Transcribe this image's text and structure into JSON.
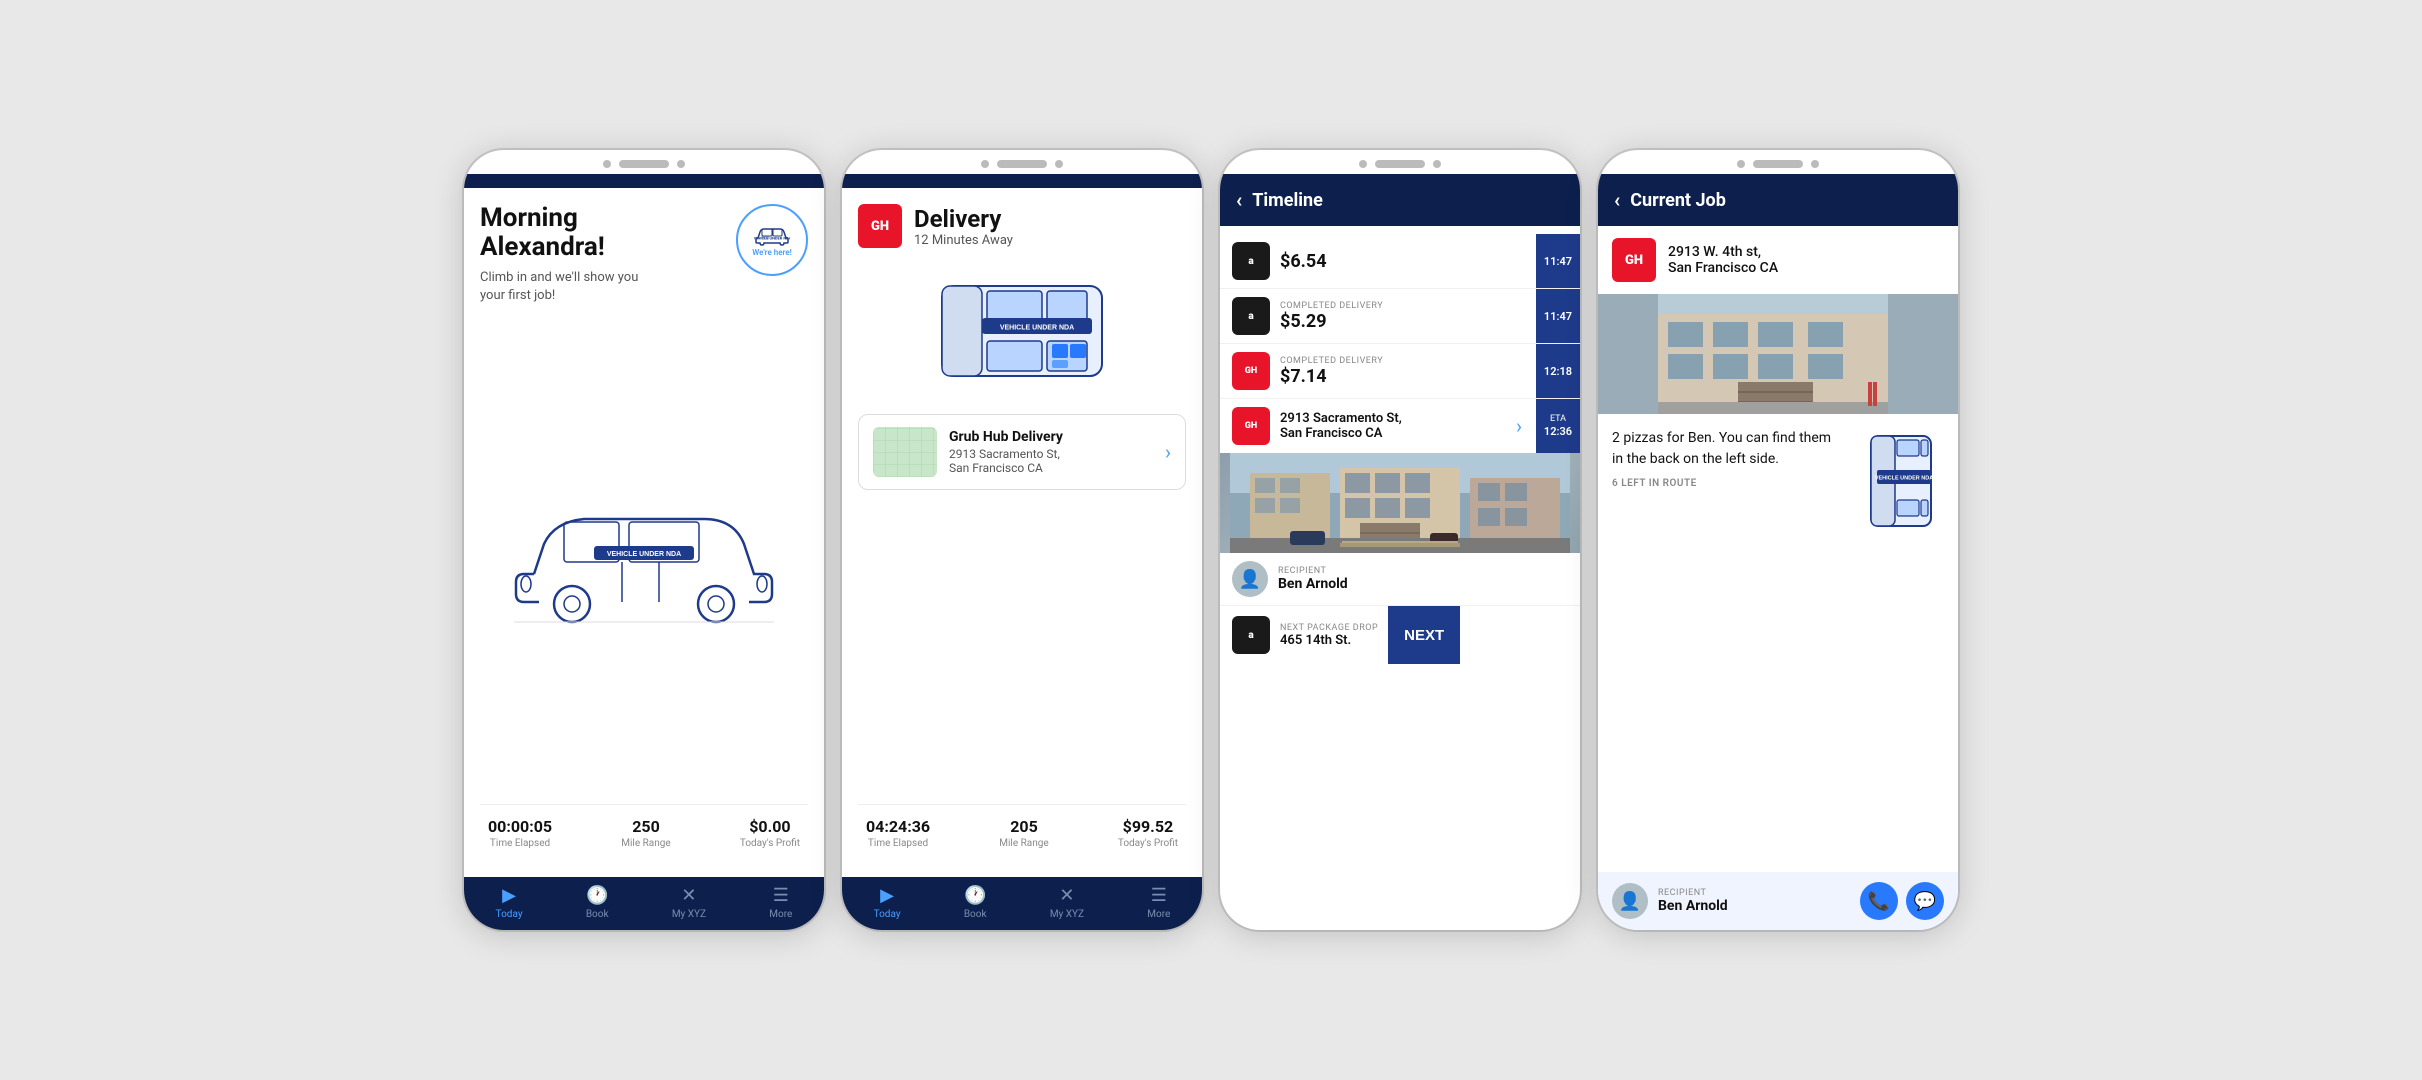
{
  "phone1": {
    "greeting_line1": "Morning",
    "greeting_line2": "Alexandra!",
    "greeting_sub": "Climb in and we'll show you your first job!",
    "were_here": "We're here!",
    "stats": {
      "time": "00:00:05",
      "time_label": "Time Elapsed",
      "miles": "250",
      "miles_label": "Mile Range",
      "profit": "$0.00",
      "profit_label": "Today's Profit"
    },
    "nav": {
      "today": "Today",
      "book": "Book",
      "myxyz": "My XYZ",
      "more": "More"
    },
    "vehicle_nda": "VEHICLE UNDER NDA"
  },
  "phone2": {
    "logo": "GH",
    "title": "Delivery",
    "subtitle": "12 Minutes Away",
    "delivery_card": {
      "name": "Grub Hub Delivery",
      "address_line1": "2913 Sacramento St,",
      "address_line2": "San Francisco CA"
    },
    "stats": {
      "time": "04:24:36",
      "time_label": "Time Elapsed",
      "miles": "205",
      "miles_label": "Mile Range",
      "profit": "$99.52",
      "profit_label": "Today's Profit"
    },
    "nav": {
      "today": "Today",
      "book": "Book",
      "myxyz": "My XYZ",
      "more": "More"
    },
    "vehicle_nda": "VEHICLE UNDER NDA"
  },
  "phone3": {
    "header_title": "Timeline",
    "items": [
      {
        "type": "amazon",
        "label": "",
        "amount": "$6.54",
        "time": "11:47"
      },
      {
        "type": "amazon",
        "label": "COMPLETED DELIVERY",
        "amount": "$5.29",
        "time": "11:47"
      },
      {
        "type": "grubhub",
        "label": "COMPLETED DELIVERY",
        "amount": "$7.14",
        "time": "12:18"
      },
      {
        "type": "grubhub",
        "address1": "2913 Sacramento St,",
        "address2": "San Francisco CA",
        "has_chevron": true,
        "eta_label": "ETA",
        "eta_time": "12:36"
      }
    ],
    "recipient": {
      "label": "RECIPIENT",
      "name": "Ben Arnold"
    },
    "next_drop": {
      "label": "NEXT PACKAGE DROP",
      "address": "465 14th St."
    },
    "next_btn": "NEXT"
  },
  "phone4": {
    "header_title": "Current Job",
    "logo": "GH",
    "address_line1": "2913 W. 4th st,",
    "address_line2": "San Francisco CA",
    "job_description": "2 pizzas for Ben. You can find them in the back on the left side.",
    "route_label": "6 LEFT IN ROUTE",
    "vehicle_nda": "VEHICLE UNDER NDA",
    "recipient": {
      "label": "RECIPIENT",
      "name": "Ben Arnold"
    }
  }
}
